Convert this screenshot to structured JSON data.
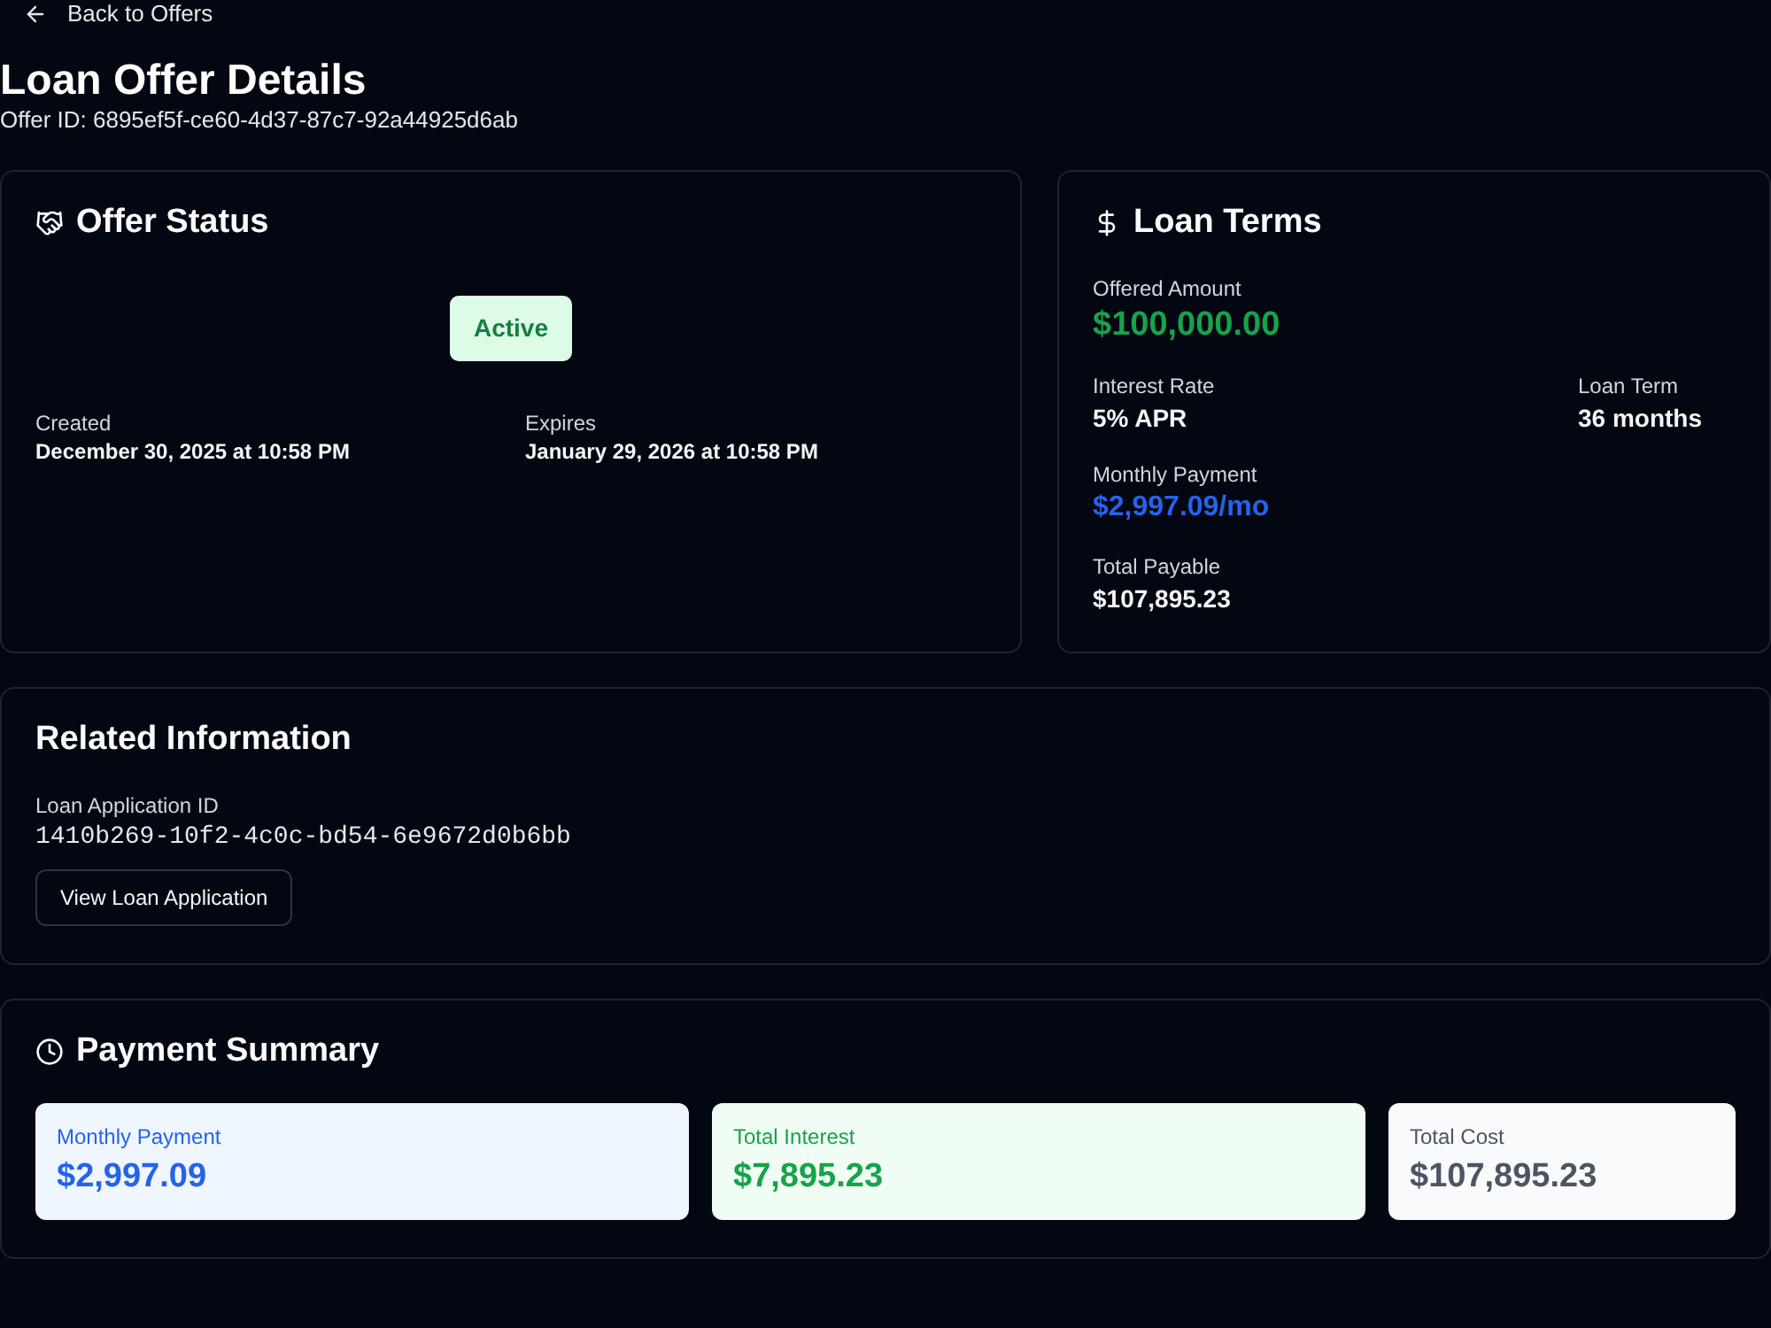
{
  "back_link": {
    "label": "Back to Offers"
  },
  "header": {
    "title": "Loan Offer Details",
    "offer_id": "Offer ID: 6895ef5f-ce60-4d37-87c7-92a44925d6ab"
  },
  "offer_status": {
    "title": "Offer Status",
    "status": {
      "label": "Active",
      "kind": "active"
    },
    "dates": [
      {
        "label": "Created",
        "value": "December 30, 2025 at 10:58 PM"
      },
      {
        "label": "Expires",
        "value": "January 29, 2026 at 10:58 PM"
      }
    ]
  },
  "loan_terms": {
    "title": "Loan Terms",
    "rows": [
      {
        "fields": [
          {
            "label": "Offered Amount",
            "value": "$100,000.00",
            "kind": "amount"
          }
        ]
      },
      {
        "fields": [
          {
            "label": "Interest Rate",
            "value": "5% APR",
            "kind": "plain"
          },
          {
            "label": "Loan Term",
            "value": "36 months",
            "kind": "plain"
          }
        ]
      },
      {
        "fields": [
          {
            "label": "Monthly Payment",
            "value": "$2,997.09/mo",
            "kind": "payment"
          }
        ]
      },
      {
        "fields": [
          {
            "label": "Total Payable",
            "value": "$107,895.23",
            "kind": "plain"
          }
        ]
      }
    ]
  },
  "related_information": {
    "title": "Related Information",
    "label": "Loan Application ID",
    "application_id": "1410b269-10f2-4c0c-bd54-6e9672d0b6bb",
    "button": "View Loan Application"
  },
  "payment_summary": {
    "title": "Payment Summary",
    "tiles": [
      {
        "label": "Monthly Payment",
        "value": "$2,997.09",
        "kind": "primary"
      },
      {
        "label": "Total Interest",
        "value": "$7,895.23",
        "kind": "success"
      },
      {
        "label": "Total Cost",
        "value": "$107,895.23",
        "kind": "neutral"
      }
    ]
  }
}
